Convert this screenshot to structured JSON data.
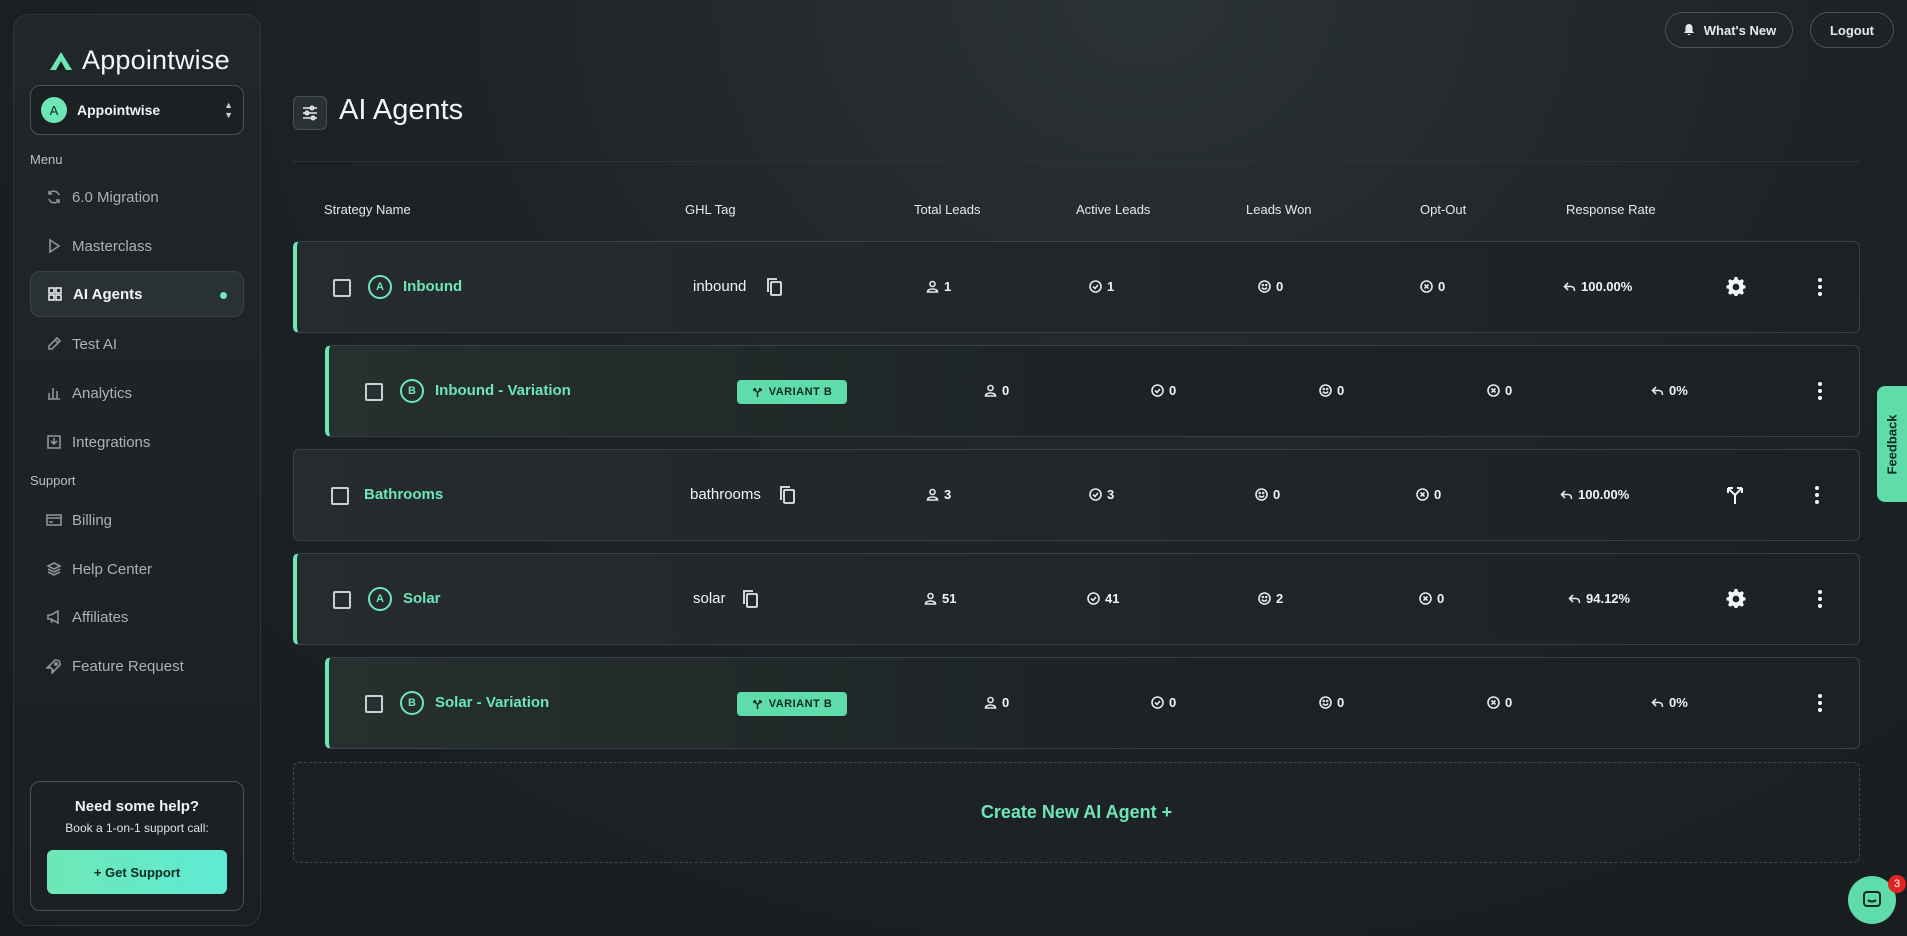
{
  "app": {
    "name": "Appointwise",
    "org": {
      "name": "Appointwise",
      "initial": "A"
    }
  },
  "sidebar": {
    "menu_label": "Menu",
    "support_label": "Support",
    "menu_items": [
      {
        "label": "6.0 Migration",
        "icon": "refresh-icon"
      },
      {
        "label": "Masterclass",
        "icon": "play-icon"
      },
      {
        "label": "AI Agents",
        "icon": "grid-icon",
        "active": true
      },
      {
        "label": "Test AI",
        "icon": "pencil-icon"
      },
      {
        "label": "Analytics",
        "icon": "bar-chart-icon"
      },
      {
        "label": "Integrations",
        "icon": "download-icon"
      }
    ],
    "support_items": [
      {
        "label": "Billing",
        "icon": "credit-card-icon"
      },
      {
        "label": "Help Center",
        "icon": "layers-icon"
      },
      {
        "label": "Affiliates",
        "icon": "megaphone-icon"
      },
      {
        "label": "Feature Request",
        "icon": "rocket-icon"
      }
    ],
    "help": {
      "title": "Need some help?",
      "subtitle": "Book a 1-on-1 support call:",
      "button": "+ Get Support"
    }
  },
  "topbar": {
    "whats_new": "What's New",
    "logout": "Logout"
  },
  "page": {
    "title": "AI Agents"
  },
  "table": {
    "headers": [
      "Strategy Name",
      "GHL Tag",
      "Total Leads",
      "Active Leads",
      "Leads Won",
      "Opt-Out",
      "Response Rate"
    ],
    "rows": [
      {
        "letter": "A",
        "name": "Inbound",
        "tag": "inbound",
        "variant_label": "",
        "total": "1",
        "active": "1",
        "won": "0",
        "optout": "0",
        "rate": "100.00%",
        "action": "gear-icon"
      },
      {
        "letter": "B",
        "name": "Inbound - Variation",
        "tag": "",
        "variant_label": "VARIANT B",
        "total": "0",
        "active": "0",
        "won": "0",
        "optout": "0",
        "rate": "0%",
        "action": ""
      },
      {
        "letter": "",
        "name": "Bathrooms",
        "tag": "bathrooms",
        "variant_label": "",
        "total": "3",
        "active": "3",
        "won": "0",
        "optout": "0",
        "rate": "100.00%",
        "action": "split-icon"
      },
      {
        "letter": "A",
        "name": "Solar",
        "tag": "solar",
        "variant_label": "",
        "total": "51",
        "active": "41",
        "won": "2",
        "optout": "0",
        "rate": "94.12%",
        "action": "gear-icon"
      },
      {
        "letter": "B",
        "name": "Solar - Variation",
        "tag": "",
        "variant_label": "VARIANT B",
        "total": "0",
        "active": "0",
        "won": "0",
        "optout": "0",
        "rate": "0%",
        "action": ""
      }
    ]
  },
  "create": {
    "label": "Create New AI Agent +"
  },
  "feedback": {
    "label": "Feedback"
  },
  "chat": {
    "badge": "3"
  },
  "colors": {
    "accent": "#6ee7b7",
    "background": "#1d2226",
    "badge": "#e02424"
  }
}
